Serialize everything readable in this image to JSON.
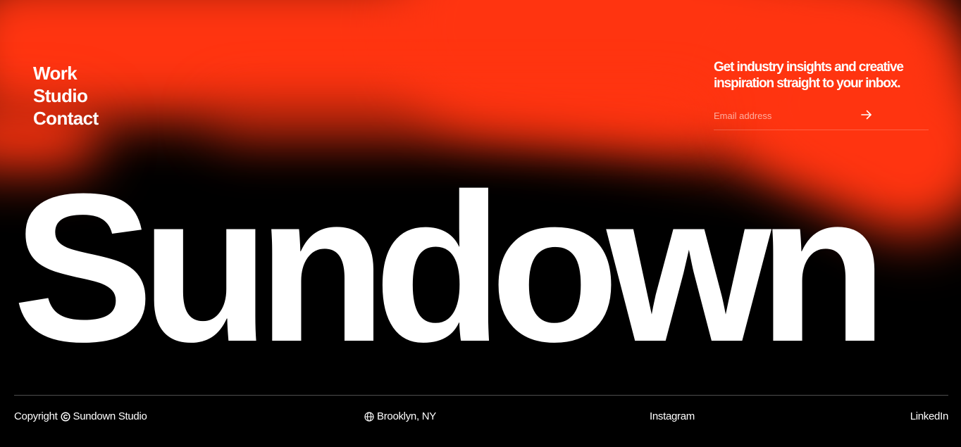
{
  "nav": {
    "items": [
      {
        "label": "Work"
      },
      {
        "label": "Studio"
      },
      {
        "label": "Contact"
      }
    ]
  },
  "newsletter": {
    "tagline_line1": "Get industry insights and creative",
    "tagline_line2": "inspiration straight to your inbox.",
    "email_placeholder": "Email address",
    "email_value": "",
    "submit_icon": "arrow-right-icon"
  },
  "hero": {
    "title": "Sundown"
  },
  "footer": {
    "copyright_prefix": "Copyright",
    "copyright_icon": "copyright-icon",
    "copyright_name": "Sundown Studio",
    "location_icon": "globe-icon",
    "location": "Brooklyn, NY",
    "instagram": "Instagram",
    "linkedin": "LinkedIn"
  },
  "colors": {
    "accent": "#ff3410",
    "background": "#000000",
    "text": "#ffffff"
  }
}
